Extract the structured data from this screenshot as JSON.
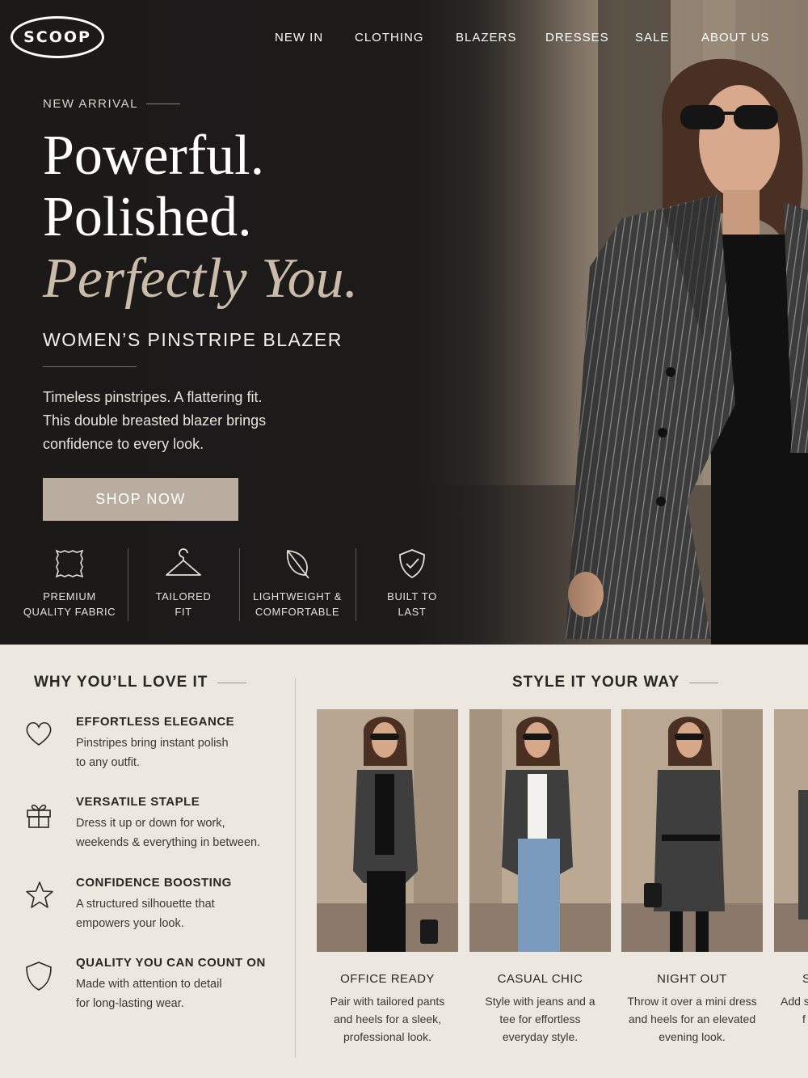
{
  "brand": {
    "logo_text": "SCOOP"
  },
  "nav": {
    "items": [
      "NEW IN",
      "CLOTHING",
      "BLAZERS",
      "DRESSES",
      "SALE",
      "ABOUT US"
    ]
  },
  "hero": {
    "eyebrow": "NEW ARRIVAL",
    "headline_1": "Powerful.",
    "headline_2": "Polished.",
    "headline_3": "Perfectly You.",
    "subtitle": "WOMEN’S PINSTRIPE BLAZER",
    "description_lines": [
      "Timeless pinstripes. A flattering fit.",
      "This double breasted blazer brings",
      "confidence to every look."
    ],
    "cta_label": "SHOP NOW",
    "features": [
      {
        "icon": "fabric-swatch-icon",
        "line1": "PREMIUM",
        "line2": "QUALITY FABRIC"
      },
      {
        "icon": "hanger-icon",
        "line1": "TAILORED",
        "line2": "FIT"
      },
      {
        "icon": "leaf-icon",
        "line1": "LIGHTWEIGHT &",
        "line2": "COMFORTABLE"
      },
      {
        "icon": "shield-check-icon",
        "line1": "BUILT TO",
        "line2": "LAST"
      }
    ]
  },
  "why": {
    "title": "WHY YOU’LL LOVE IT",
    "items": [
      {
        "icon": "heart-icon",
        "title": "EFFORTLESS ELEGANCE",
        "desc": [
          "Pinstripes bring instant polish",
          "to any outfit."
        ]
      },
      {
        "icon": "gift-icon",
        "title": "VERSATILE STAPLE",
        "desc": [
          "Dress it up or down for work,",
          "weekends & everything in between."
        ]
      },
      {
        "icon": "star-icon",
        "title": "CONFIDENCE BOOSTING",
        "desc": [
          "A structured silhouette that",
          "empowers your look."
        ]
      },
      {
        "icon": "shield-icon",
        "title": "QUALITY YOU CAN COUNT ON",
        "desc": [
          "Made with attention to detail",
          "for long-lasting wear."
        ]
      }
    ]
  },
  "style": {
    "title": "STYLE IT YOUR WAY",
    "looks": [
      {
        "title": "OFFICE READY",
        "desc": [
          "Pair with tailored pants",
          "and heels for a sleek,",
          "professional look."
        ]
      },
      {
        "title": "CASUAL CHIC",
        "desc": [
          "Style with jeans and a",
          "tee for effortless",
          "everyday style."
        ]
      },
      {
        "title": "NIGHT OUT",
        "desc": [
          "Throw it over a mini dress",
          "and heels for an elevated",
          "evening look."
        ]
      },
      {
        "title": "S",
        "desc": [
          "Add s",
          "f"
        ]
      }
    ]
  },
  "colors": {
    "hero_bg": "#1c1b1a",
    "accent_beige": "#b9ada0",
    "headline_italic": "#cbbba9",
    "page_bg": "#ece7e1"
  }
}
